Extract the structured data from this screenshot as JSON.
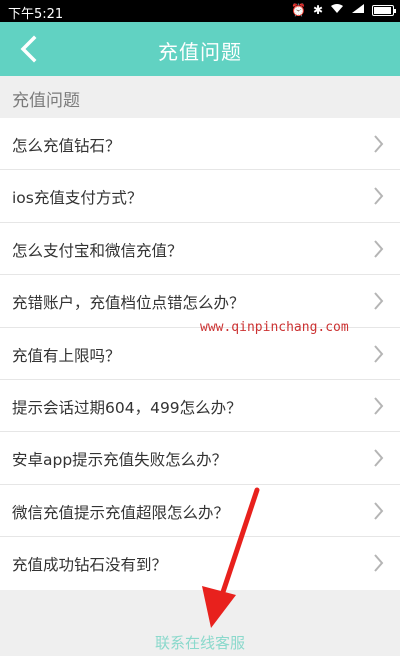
{
  "status_bar": {
    "time": "下午5:21",
    "icons": [
      "alarm-icon",
      "bluetooth-icon",
      "wifi-icon",
      "signal-icon",
      "battery-icon"
    ],
    "background": "#000000"
  },
  "nav": {
    "title": "充值问题",
    "back_icon": "chevron-left-icon",
    "color": "#61d2c2"
  },
  "section": {
    "title": "充值问题"
  },
  "items": [
    {
      "label": "怎么充值钻石？"
    },
    {
      "label": "ios充值支付方式？"
    },
    {
      "label": "怎么支付宝和微信充值？"
    },
    {
      "label": "充错账户，充值档位点错怎么办？"
    },
    {
      "label": "充值有上限吗？"
    },
    {
      "label": "提示会话过期604，499怎么办？"
    },
    {
      "label": "安卓app提示充值失败怎么办？"
    },
    {
      "label": "微信充值提示充值超限怎么办？"
    },
    {
      "label": "充值成功钻石没有到？"
    }
  ],
  "watermark": "www.qinpinchang.com",
  "contact": {
    "label": "联系在线客服",
    "color": "#8bd9cc"
  },
  "annotation_arrow_color": "#e8211d"
}
